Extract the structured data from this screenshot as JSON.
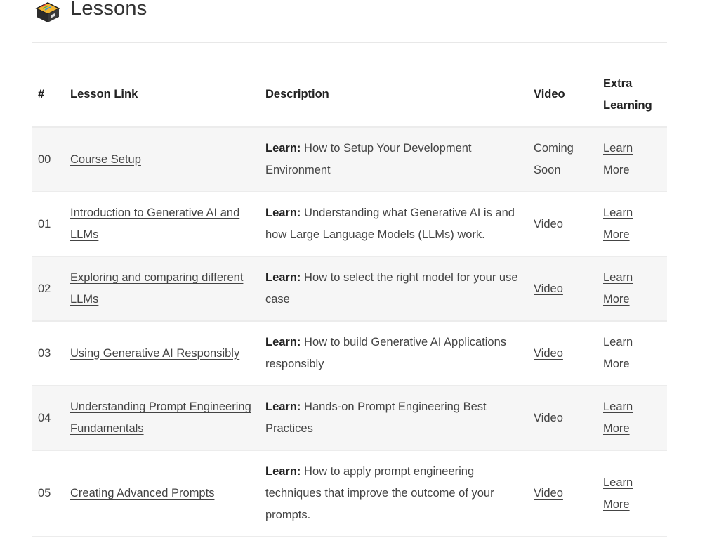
{
  "header": {
    "title": "Lessons",
    "icon": "card-file-box-icon"
  },
  "table": {
    "columns": {
      "num": "#",
      "lesson": "Lesson Link",
      "description": "Description",
      "video": "Video",
      "extra_line1": "Extra",
      "extra_line2": "Learning"
    },
    "rows": [
      {
        "num": "00",
        "lesson": "Course Setup",
        "desc_label": "Learn:",
        "desc_text": " How to Setup Your Development Environment",
        "video": "Coming Soon",
        "video_is_link": false,
        "extra": "Learn More"
      },
      {
        "num": "01",
        "lesson": "Introduction to Generative AI and LLMs",
        "desc_label": "Learn:",
        "desc_text": " Understanding what Generative AI is and how Large Language Models (LLMs) work.",
        "video": "Video",
        "video_is_link": true,
        "extra": "Learn More"
      },
      {
        "num": "02",
        "lesson": "Exploring and comparing different LLMs",
        "desc_label": "Learn:",
        "desc_text": " How to select the right model for your use case",
        "video": "Video",
        "video_is_link": true,
        "extra": "Learn More"
      },
      {
        "num": "03",
        "lesson": "Using Generative AI Responsibly",
        "desc_label": "Learn:",
        "desc_text": " How to build Generative AI Applications responsibly",
        "video": "Video",
        "video_is_link": true,
        "extra": "Learn More"
      },
      {
        "num": "04",
        "lesson": "Understanding Prompt Engineering Fundamentals",
        "desc_label": "Learn:",
        "desc_text": " Hands-on Prompt Engineering Best Practices",
        "video": "Video",
        "video_is_link": true,
        "extra": "Learn More"
      },
      {
        "num": "05",
        "lesson": "Creating Advanced Prompts",
        "desc_label": "Learn:",
        "desc_text": " How to apply prompt engineering techniques that improve the outcome of your prompts.",
        "video": "Video",
        "video_is_link": true,
        "extra": "Learn More"
      }
    ]
  }
}
